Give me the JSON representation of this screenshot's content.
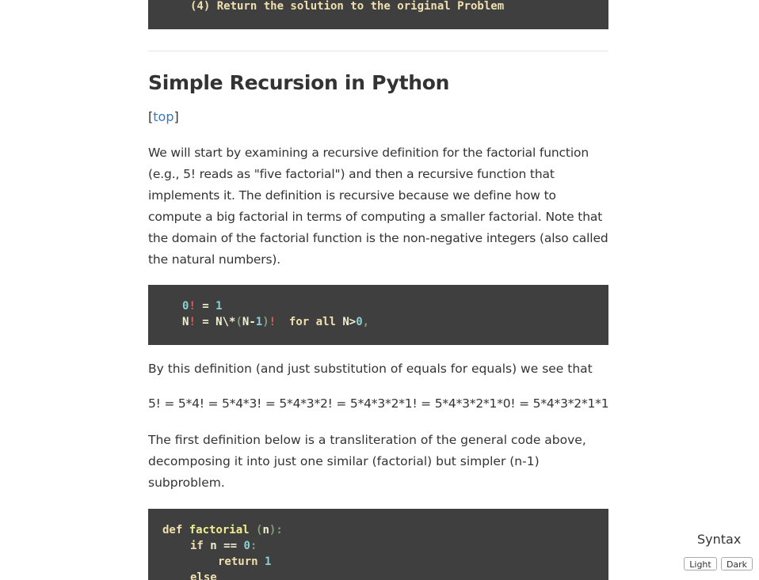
{
  "code_top": {
    "line": "(4) Return the solution to the original Problem"
  },
  "section": {
    "heading": "Simple Recursion in Python",
    "top_link_open": "[",
    "top_link": "top",
    "top_link_close": "]",
    "paragraph1": "We will start by examining a recursive definition for the factorial function (e.g., 5! reads as \"five factorial\") and then a recursive function that implements it. The definition is recursive because we define how to compute a big factorial in terms of computing a smaller factorial. Note that the domain of the factorial function is the non-negative integers (also called the natural numbers).",
    "paragraph2": "By this definition (and just substitution of equals for equals) we see that",
    "paragraph3": "5! = 5*4! = 5*4*3! = 5*4*3*2! = 5*4*3*2*1! = 5*4*3*2*1*0! = 5*4*3*2*1*1",
    "paragraph4": "The first definition below is a transliteration of the general code above, decomposing it into just one similar (factorial) but simpler (n-1) subproblem."
  },
  "code_def": {
    "line1": {
      "zero": "0",
      "bang": "!",
      "eq": " = ",
      "one": "1"
    },
    "line2": {
      "n": "N",
      "bang": "!",
      "eq": " = N\\*",
      "paren_open": "(",
      "n_minus": "N-",
      "one": "1",
      "paren_close": ")",
      "bang2": "!",
      "for": "  for ",
      "all": "all",
      "cond": " N>",
      "zero": "0",
      "comma": ","
    }
  },
  "code_fn": {
    "def": "def",
    "name": "factorial",
    "sig_open": " (",
    "arg": "n",
    "sig_close": "):",
    "if": "if",
    "cond": " n == ",
    "zero": "0",
    "colon": ":",
    "return": "return",
    "one": "1",
    "else": "else"
  },
  "syntax_panel": {
    "title": "Syntax",
    "light": "Light",
    "dark": "Dark"
  },
  "colors": {
    "code_bg": "#3f3f3f",
    "link": "#3779c1",
    "keyword": "#f0dfaf",
    "number": "#8cd0d3",
    "bang": "#e35b5b"
  }
}
